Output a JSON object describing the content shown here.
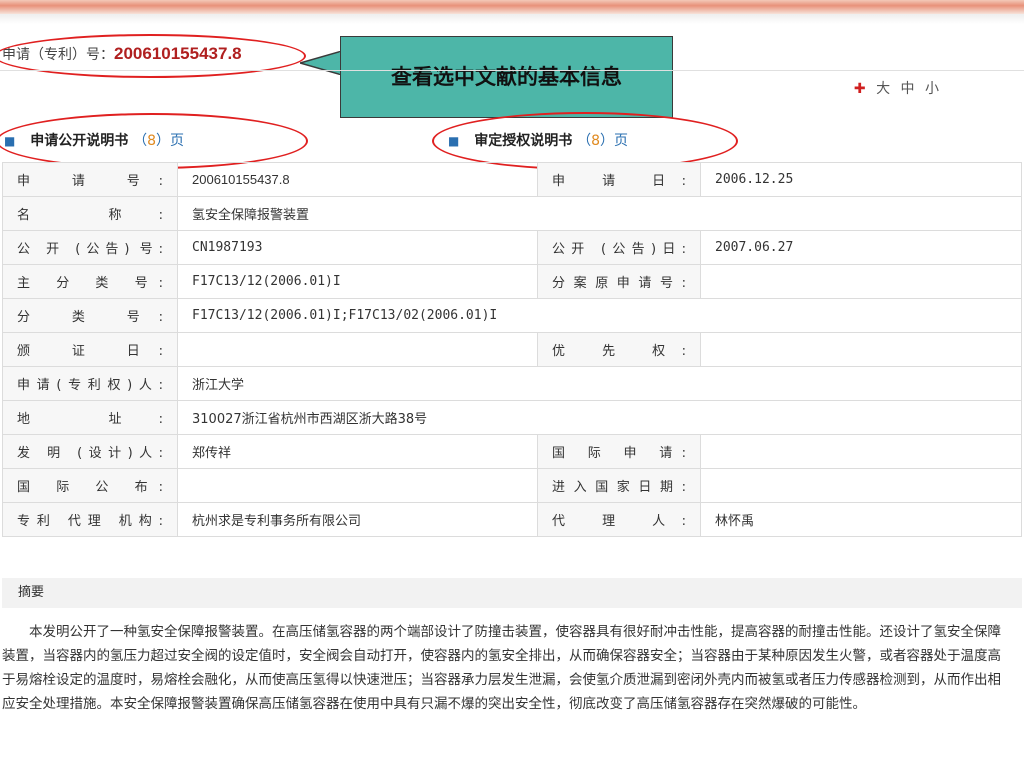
{
  "header": {
    "app_no_label": "申请（专利）号：",
    "app_no_value": "200610155437.8",
    "callout": "查看选中文献的基本信息",
    "font_size_plus": "✚",
    "font_size_options": "大 中 小"
  },
  "tabs": [
    {
      "label": "申请公开说明书",
      "count_open": "（",
      "count": "8",
      "count_close": "）页"
    },
    {
      "label": "审定授权说明书",
      "count_open": "（",
      "count": "8",
      "count_close": "）页"
    }
  ],
  "rows": [
    {
      "l1": "申 请 号:",
      "v1": "200610155437.8",
      "l2": "申 请 日:",
      "v2": "2006.12.25"
    },
    {
      "l1": "名 称:",
      "v1": "氢安全保障报警装置"
    },
    {
      "l1": "公 开 (公告) 号:",
      "v1": "CN1987193",
      "l2": "公开 (公告)日:",
      "v2": "2007.06.27"
    },
    {
      "l1": "主 分 类 号:",
      "v1": "F17C13/12(2006.01)I",
      "l2": "分案原申请号:",
      "v2": ""
    },
    {
      "l1": "分 类 号:",
      "v1": "F17C13/12(2006.01)I;F17C13/02(2006.01)I"
    },
    {
      "l1": "颁 证 日:",
      "v1": "",
      "l2": "优 先 权:",
      "v2": ""
    },
    {
      "l1": "申请(专利权)人:",
      "v1": "浙江大学"
    },
    {
      "l1": "地 址:",
      "v1": "310027浙江省杭州市西湖区浙大路38号"
    },
    {
      "l1": "发 明 (设计)人:",
      "v1": "郑传祥",
      "l2": "国 际 申 请:",
      "v2": ""
    },
    {
      "l1": "国 际 公 布:",
      "v1": "",
      "l2": "进入国家日期:",
      "v2": ""
    },
    {
      "l1": "专利 代理 机构:",
      "v1": "杭州求是专利事务所有限公司",
      "l2": "代 理 人:",
      "v2": "林怀禹"
    }
  ],
  "abstract": {
    "title": "摘要",
    "text": "本发明公开了一种氢安全保障报警装置。在高压储氢容器的两个端部设计了防撞击装置，使容器具有很好耐冲击性能，提高容器的耐撞击性能。还设计了氢安全保障装置，当容器内的氢压力超过安全阀的设定值时，安全阀会自动打开，使容器内的氢安全排出，从而确保容器安全；当容器由于某种原因发生火警，或者容器处于温度高于易熔栓设定的温度时，易熔栓会融化，从而使高压氢得以快速泄压；当容器承力层发生泄漏，会使氢介质泄漏到密闭外壳内而被氢或者压力传感器检测到，从而作出相应安全处理措施。本安全保障报警装置确保高压储氢容器在使用中具有只漏不爆的突出安全性，彻底改变了高压储氢容器存在突然爆破的可能性。"
  },
  "colors": {
    "accent_red": "#e02020",
    "callout_bg": "#4db6a8",
    "link_blue": "#2a6fb0"
  }
}
